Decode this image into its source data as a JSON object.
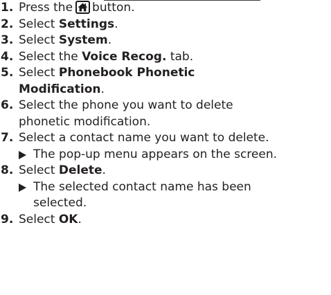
{
  "steps": [
    {
      "num": "1.",
      "before": "Press the",
      "icon": "home-icon",
      "after": "button."
    },
    {
      "num": "2.",
      "before": "Select ",
      "bold": "Settings",
      "after": "."
    },
    {
      "num": "3.",
      "before": "Select ",
      "bold": "System",
      "after": "."
    },
    {
      "num": "4.",
      "before": "Select the ",
      "bold": "Voice Recog.",
      "after": " tab."
    },
    {
      "num": "5.",
      "before": "Select ",
      "bold_line1": "Phonebook Phonetic",
      "bold_line2": "Modification",
      "after": "."
    },
    {
      "num": "6.",
      "line1": "Select the phone you want to delete",
      "line2": "phonetic modification."
    },
    {
      "num": "7.",
      "text": "Select a contact name you want to delete.",
      "result": "The pop-up menu appears on the screen."
    },
    {
      "num": "8.",
      "before": "Select ",
      "bold": "Delete",
      "after": ".",
      "result_line1": "The selected contact name has been",
      "result_line2": "selected."
    },
    {
      "num": "9.",
      "before": "Select ",
      "bold": "OK",
      "after": "."
    }
  ]
}
